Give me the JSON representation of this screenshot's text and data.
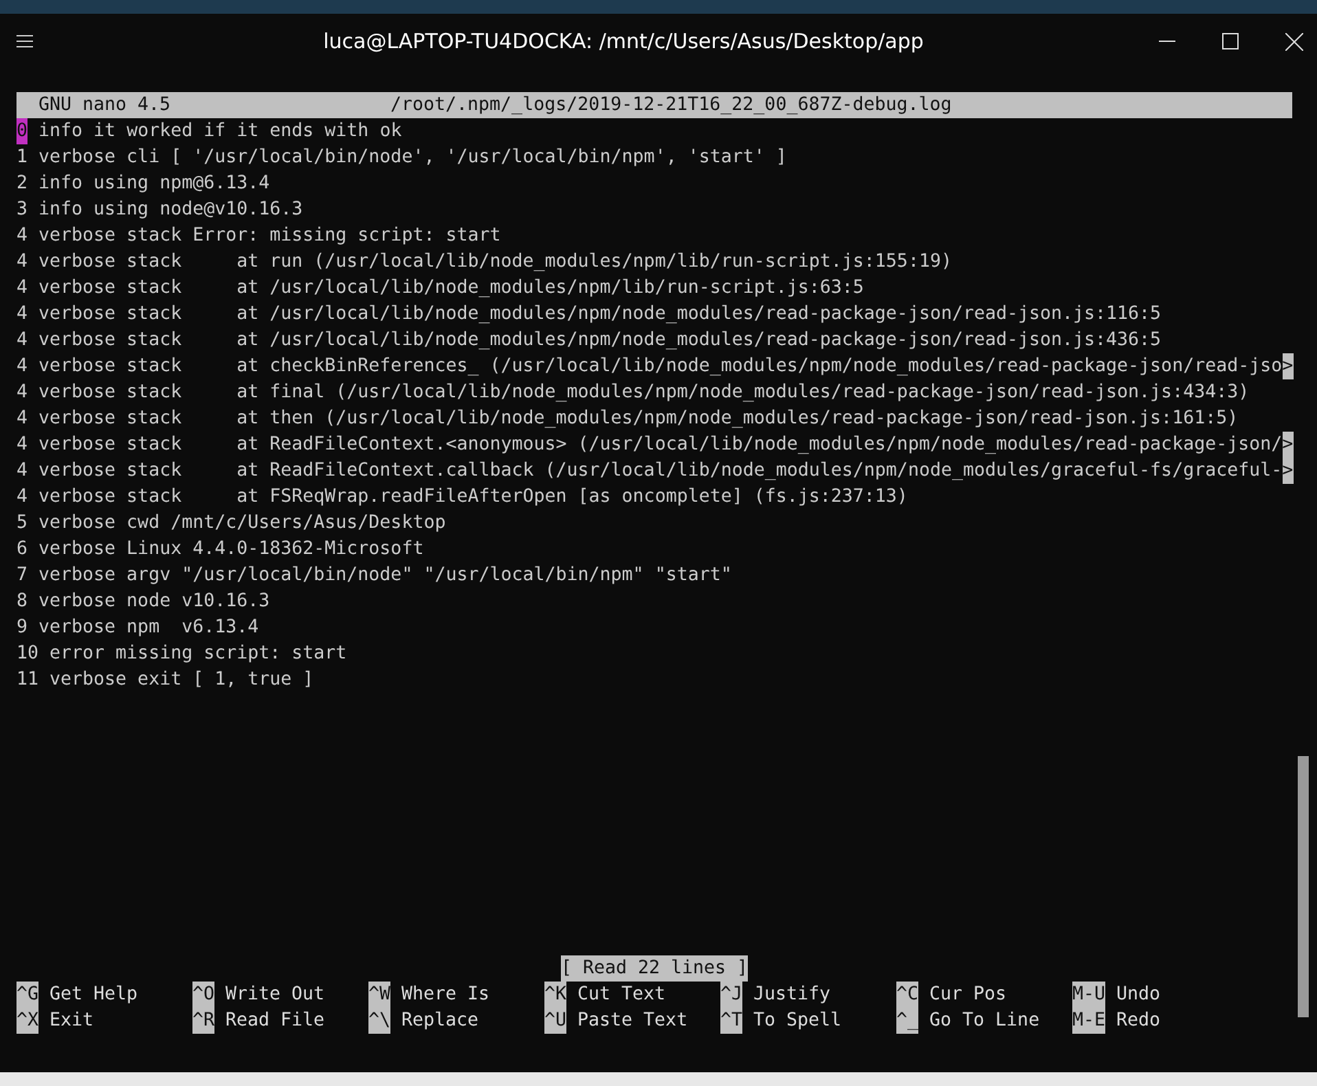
{
  "window": {
    "title": "luca@LAPTOP-TU4DOCKA: /mnt/c/Users/Asus/Desktop/app"
  },
  "nano": {
    "version": "GNU nano 4.5",
    "file": "/root/.npm/_logs/2019-12-21T16_22_00_687Z-debug.log",
    "lines": [
      {
        "cursor": "0",
        "text": " info it worked if it ends with ok"
      },
      {
        "text": "1 verbose cli [ '/usr/local/bin/node', '/usr/local/bin/npm', 'start' ]"
      },
      {
        "text": "2 info using npm@6.13.4"
      },
      {
        "text": "3 info using node@v10.16.3"
      },
      {
        "text": "4 verbose stack Error: missing script: start"
      },
      {
        "text": "4 verbose stack     at run (/usr/local/lib/node_modules/npm/lib/run-script.js:155:19)"
      },
      {
        "text": "4 verbose stack     at /usr/local/lib/node_modules/npm/lib/run-script.js:63:5"
      },
      {
        "text": "4 verbose stack     at /usr/local/lib/node_modules/npm/node_modules/read-package-json/read-json.js:116:5"
      },
      {
        "text": "4 verbose stack     at /usr/local/lib/node_modules/npm/node_modules/read-package-json/read-json.js:436:5"
      },
      {
        "text": "4 verbose stack     at checkBinReferences_ (/usr/local/lib/node_modules/npm/node_modules/read-package-json/read-jso",
        "more": ">"
      },
      {
        "text": "4 verbose stack     at final (/usr/local/lib/node_modules/npm/node_modules/read-package-json/read-json.js:434:3)"
      },
      {
        "text": "4 verbose stack     at then (/usr/local/lib/node_modules/npm/node_modules/read-package-json/read-json.js:161:5)"
      },
      {
        "text": "4 verbose stack     at ReadFileContext.<anonymous> (/usr/local/lib/node_modules/npm/node_modules/read-package-json/",
        "more": ">"
      },
      {
        "text": "4 verbose stack     at ReadFileContext.callback (/usr/local/lib/node_modules/npm/node_modules/graceful-fs/graceful-",
        "more": ">"
      },
      {
        "text": "4 verbose stack     at FSReqWrap.readFileAfterOpen [as oncomplete] (fs.js:237:13)"
      },
      {
        "text": "5 verbose cwd /mnt/c/Users/Asus/Desktop"
      },
      {
        "text": "6 verbose Linux 4.4.0-18362-Microsoft"
      },
      {
        "text": "7 verbose argv \"/usr/local/bin/node\" \"/usr/local/bin/npm\" \"start\""
      },
      {
        "text": "8 verbose node v10.16.3"
      },
      {
        "text": "9 verbose npm  v6.13.4"
      },
      {
        "text": "10 error missing script: start"
      },
      {
        "text": "11 verbose exit [ 1, true ]"
      }
    ],
    "status": "[ Read 22 lines ]",
    "shortcuts": [
      {
        "key": "^G",
        "label": "Get Help"
      },
      {
        "key": "^O",
        "label": "Write Out"
      },
      {
        "key": "^W",
        "label": "Where Is"
      },
      {
        "key": "^K",
        "label": "Cut Text"
      },
      {
        "key": "^J",
        "label": "Justify"
      },
      {
        "key": "^C",
        "label": "Cur Pos"
      },
      {
        "key": "M-U",
        "label": "Undo"
      },
      {
        "key": "^X",
        "label": "Exit"
      },
      {
        "key": "^R",
        "label": "Read File"
      },
      {
        "key": "^\\",
        "label": "Replace"
      },
      {
        "key": "^U",
        "label": "Paste Text"
      },
      {
        "key": "^T",
        "label": "To Spell"
      },
      {
        "key": "^_",
        "label": "Go To Line"
      },
      {
        "key": "M-E",
        "label": "Redo"
      }
    ]
  }
}
